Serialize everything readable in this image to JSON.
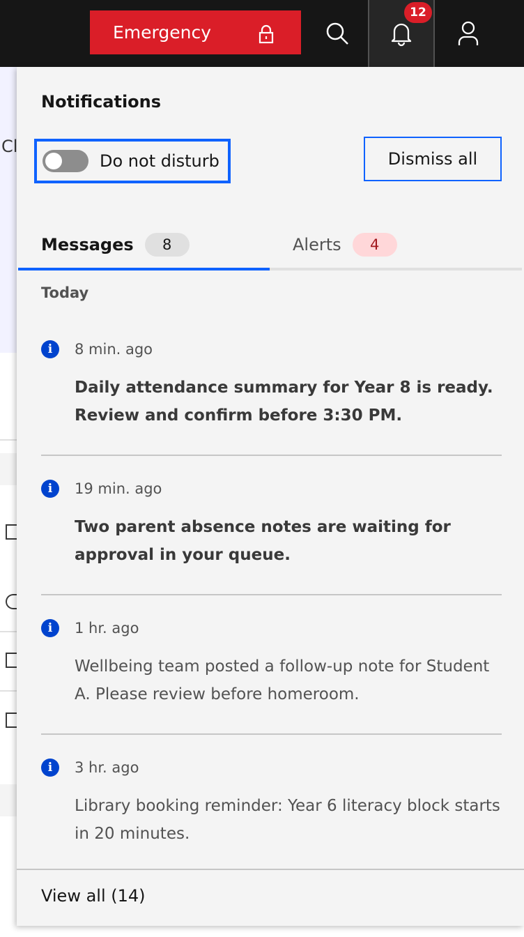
{
  "header": {
    "emergency_label": "Emergency",
    "notification_count": "12"
  },
  "panel": {
    "title": "Notifications",
    "dnd_label": "Do not disturb",
    "dnd_enabled": false,
    "dismiss_label": "Dismiss all",
    "tabs": [
      {
        "label": "Messages",
        "count": "8",
        "selected": true
      },
      {
        "label": "Alerts",
        "count": "4",
        "selected": false
      }
    ],
    "group_label": "Today",
    "notifications": [
      {
        "time": "8 min. ago",
        "text": "Daily attendance summary for Year 8 is ready. Review and confirm before 3:30 PM.",
        "unread": true,
        "icon": "info-icon"
      },
      {
        "time": "19 min. ago",
        "text": "Two parent absence notes are waiting for approval in your queue.",
        "unread": true,
        "icon": "info-icon"
      },
      {
        "time": "1 hr. ago",
        "text": "Wellbeing team posted a follow-up note for Student A. Please review before homeroom.",
        "unread": false,
        "icon": "info-icon"
      },
      {
        "time": "3 hr. ago",
        "text": "Library booking reminder: Year 6 literacy block starts in 20 minutes.",
        "unread": false,
        "icon": "info-icon"
      }
    ],
    "view_all_label": "View all (14)"
  },
  "background": {
    "fragment": "Cl"
  },
  "colors": {
    "accent": "#0f62fe",
    "emergency": "#da1e28",
    "info": "#0043ce",
    "alert_badge_bg": "#ffd7d9"
  }
}
